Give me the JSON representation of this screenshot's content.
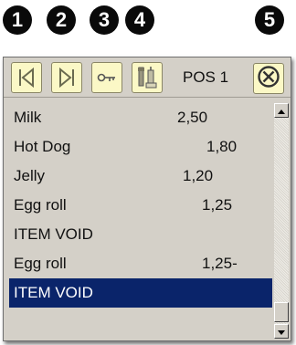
{
  "callouts": [
    "1",
    "2",
    "3",
    "4",
    "5"
  ],
  "toolbar": {
    "buttons": [
      {
        "icon": "first-record-icon"
      },
      {
        "icon": "last-record-icon"
      },
      {
        "icon": "key-icon"
      },
      {
        "icon": "tools-icon"
      }
    ],
    "pos_label": "POS 1",
    "close_icon": "close-circle-icon"
  },
  "items": [
    {
      "name": "Milk",
      "price": "2,50"
    },
    {
      "name": "Hot Dog",
      "price": "1,80"
    },
    {
      "name": "Jelly",
      "price": "1,20"
    },
    {
      "name": "Egg roll",
      "price": "1,25"
    },
    {
      "name": "ITEM VOID",
      "price": ""
    },
    {
      "name": "Egg roll",
      "price": "1,25-"
    },
    {
      "name": "ITEM VOID",
      "price": ""
    }
  ],
  "selected_index": 6,
  "colors": {
    "selection": "#0a246a",
    "button_face": "#fbf8c6",
    "panel": "#d4d0c8"
  }
}
